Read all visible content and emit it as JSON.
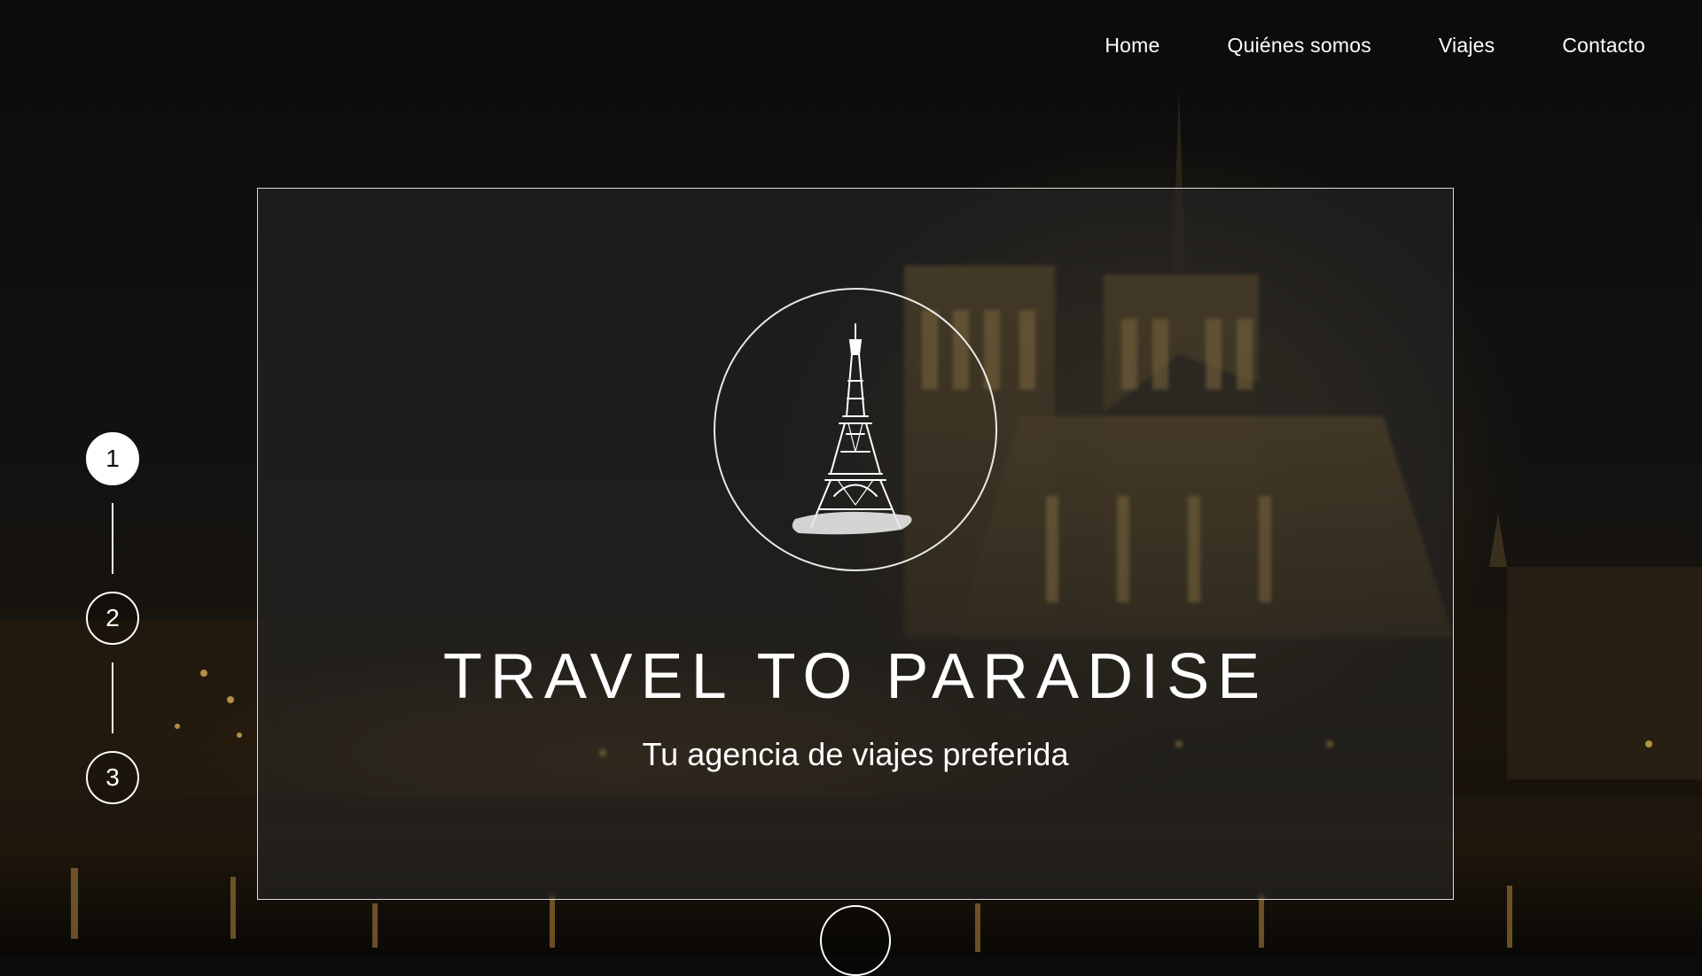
{
  "nav": {
    "items": [
      {
        "label": "Home"
      },
      {
        "label": "Quiénes somos"
      },
      {
        "label": "Viajes"
      },
      {
        "label": "Contacto"
      }
    ]
  },
  "steps": [
    {
      "label": "1",
      "active": true
    },
    {
      "label": "2",
      "active": false
    },
    {
      "label": "3",
      "active": false
    }
  ],
  "hero": {
    "title": "TRAVEL TO PARADISE",
    "subtitle": "Tu agencia de viajes preferida",
    "emblem_icon": "eiffel-tower-icon"
  },
  "colors": {
    "text": "#ffffff",
    "background": "#0b0b0b",
    "card_overlay": "rgba(40,40,40,0.55)",
    "city_light": "#c9953e"
  }
}
